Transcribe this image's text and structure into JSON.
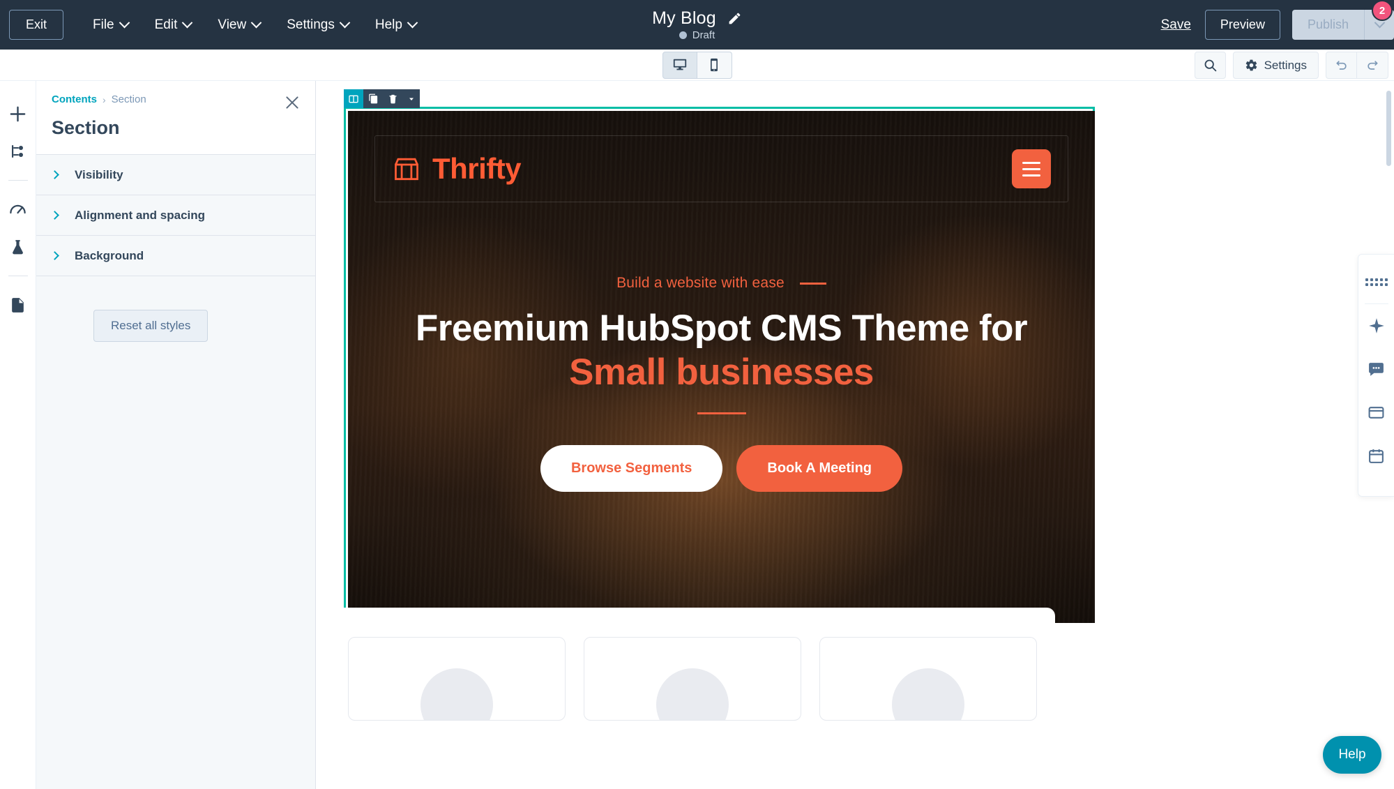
{
  "topbar": {
    "exit_label": "Exit",
    "menus": [
      {
        "label": "File",
        "icon": "chevron-down-icon"
      },
      {
        "label": "Edit",
        "icon": "chevron-down-icon"
      },
      {
        "label": "View",
        "icon": "chevron-down-icon"
      },
      {
        "label": "Settings",
        "icon": "chevron-down-icon"
      },
      {
        "label": "Help",
        "icon": "chevron-down-icon"
      }
    ],
    "title": "My Blog",
    "title_edit_icon": "pencil-icon",
    "status": "Draft",
    "save_label": "Save",
    "preview_label": "Preview",
    "publish_label": "Publish",
    "notification_count": "2",
    "bg_color": "#253342"
  },
  "subbar": {
    "devices": [
      {
        "name": "desktop",
        "icon": "desktop-icon",
        "selected": true
      },
      {
        "name": "mobile",
        "icon": "mobile-icon",
        "selected": false
      }
    ],
    "search_icon": "search-icon",
    "settings_label": "Settings",
    "settings_icon": "gear-icon",
    "undo_icon": "undo-icon",
    "redo_icon": "redo-icon"
  },
  "left_rail": {
    "items": [
      {
        "name": "add",
        "icon": "plus-icon"
      },
      {
        "name": "contents-tree",
        "icon": "tree-structure-icon"
      },
      {
        "name": "optimize",
        "icon": "speedometer-icon"
      },
      {
        "name": "ab-test",
        "icon": "flask-icon"
      },
      {
        "name": "page-details",
        "icon": "document-icon"
      }
    ]
  },
  "panel": {
    "breadcrumb": {
      "root": "Contents",
      "separator": "›",
      "current": "Section"
    },
    "title": "Section",
    "close_icon": "close-icon",
    "accordions": [
      {
        "label": "Visibility",
        "icon": "chevron-right-icon",
        "expanded": false
      },
      {
        "label": "Alignment and spacing",
        "icon": "chevron-right-icon",
        "expanded": false
      },
      {
        "label": "Background",
        "icon": "chevron-right-icon",
        "expanded": false
      }
    ],
    "reset_label": "Reset all styles",
    "accent_color": "#00a4bd"
  },
  "section_toolbar": {
    "buttons": [
      {
        "name": "layout",
        "icon": "layout-columns-icon",
        "active": true
      },
      {
        "name": "clone",
        "icon": "copy-icon",
        "active": false
      },
      {
        "name": "delete",
        "icon": "trash-icon",
        "active": false
      },
      {
        "name": "more",
        "icon": "caret-down-icon",
        "active": false
      }
    ],
    "selection_color": "#00bda5"
  },
  "preview": {
    "brand_name": "Thrifty",
    "brand_logo_icon": "storefront-icon",
    "menu_icon": "hamburger-icon",
    "eyebrow": "Build a website with ease",
    "heading_line1": "Freemium HubSpot CMS Theme for",
    "heading_line2": "Small businesses",
    "primary_button": "Book A Meeting",
    "secondary_button": "Browse Segments",
    "accent_color": "#f2613f"
  },
  "right_rail": {
    "items": [
      {
        "name": "apps-grid",
        "icon": "grid-dots-icon"
      },
      {
        "name": "ai-assistant",
        "icon": "sparkle-icon"
      },
      {
        "name": "chat",
        "icon": "chat-bubble-icon"
      },
      {
        "name": "inbox",
        "icon": "inbox-icon"
      },
      {
        "name": "meetings",
        "icon": "calendar-icon"
      }
    ],
    "help_label": "Help"
  }
}
